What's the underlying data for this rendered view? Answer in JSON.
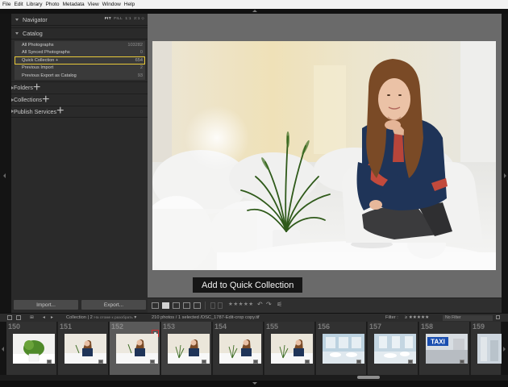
{
  "menubar": [
    "File",
    "Edit",
    "Library",
    "Photo",
    "Metadata",
    "View",
    "Window",
    "Help"
  ],
  "navigator": {
    "title": "Navigator",
    "zoom": {
      "fit": "FIT",
      "fill": "FILL",
      "one": "1:1",
      "two": "2:1"
    }
  },
  "catalog": {
    "title": "Catalog",
    "items": [
      {
        "label": "All Photographs",
        "count": "103282"
      },
      {
        "label": "All Synced Photographs",
        "count": "0"
      },
      {
        "label": "Quick Collection +",
        "count": "654"
      },
      {
        "label": "Previous Import",
        "count": "2"
      },
      {
        "label": "Previous Export as Catalog",
        "count": "93"
      }
    ]
  },
  "sections": {
    "folders": "Folders",
    "collections": "Collections",
    "publish": "Publish Services"
  },
  "buttons": {
    "import": "Import...",
    "export": "Export..."
  },
  "tooltip": "Add to Quick Collection",
  "toolbar": {
    "stars": "★★★★★"
  },
  "filmstrip_bar": {
    "source_prefix": "Collection",
    "source_sep": "|",
    "source_num": "2",
    "source_small": "На отоме к разобрать",
    "selection": "210 photos / 1 selected /DSC_1787-Edit-crop copy.tif",
    "filter_label": "Filter :",
    "filter_stars": "≥ ★★★★★",
    "filter_value": "No Filter"
  },
  "filmstrip": [
    {
      "num": "150",
      "scene": "plant"
    },
    {
      "num": "151",
      "scene": "woman"
    },
    {
      "num": "152",
      "scene": "woman"
    },
    {
      "num": "153",
      "scene": "woman-plant"
    },
    {
      "num": "154",
      "scene": "woman-plant"
    },
    {
      "num": "155",
      "scene": "woman-plant"
    },
    {
      "num": "156",
      "scene": "blue-room"
    },
    {
      "num": "157",
      "scene": "blue-room"
    },
    {
      "num": "158",
      "scene": "taxi"
    },
    {
      "num": "159",
      "scene": "building"
    }
  ],
  "taxi_sign": "TAXI",
  "colors": {
    "quick_collection_outline": "#e8c93a",
    "target_marker": "#d42b2b",
    "panel": "#2a2a2a",
    "main_bg": "#6a6a6a"
  }
}
